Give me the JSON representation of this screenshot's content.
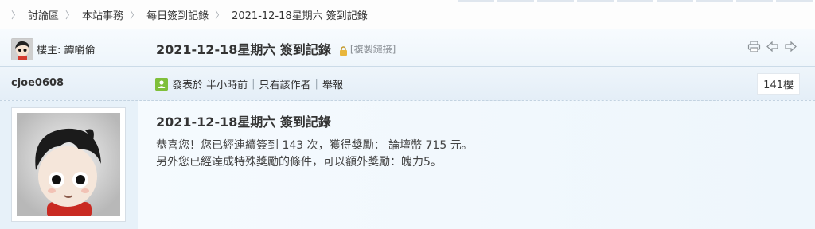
{
  "breadcrumb": {
    "items": [
      "討論區",
      "本站事務",
      "每日簽到記錄",
      "2021-12-18星期六 簽到記錄"
    ]
  },
  "thread": {
    "op_label": "樓主: 譚皭倫",
    "title": "2021-12-18星期六 簽到記錄",
    "copy_link": "[複製鏈接]",
    "tools": [
      "print-icon",
      "prev-thread-icon",
      "next-thread-icon"
    ]
  },
  "post": {
    "author": "cjoe0608",
    "posted": "發表於 半小時前",
    "only_author": "只看該作者",
    "report": "舉報",
    "floor": "141樓",
    "title": "2021-12-18星期六 簽到記錄",
    "line1": "恭喜您！您已經連續簽到 143 次，獲得獎勵： 論壇幣 715 元。",
    "line2": "另外您已經達成特殊獎勵的條件，可以額外獎勵：魄力5。"
  },
  "colors": {
    "accent": "#7fbf3a",
    "header_bg": "#eef5fb"
  }
}
